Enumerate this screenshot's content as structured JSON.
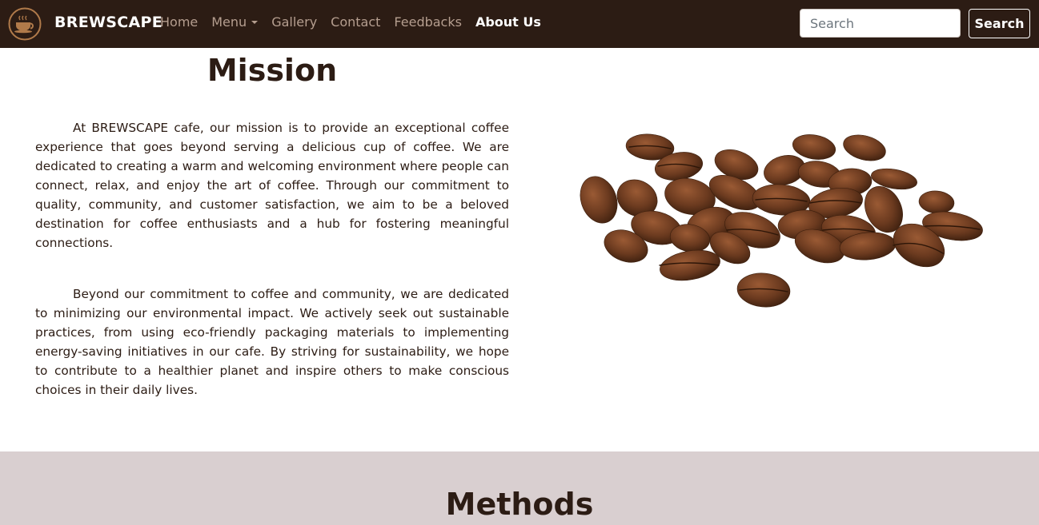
{
  "navbar": {
    "brand": "BREWSCAPE",
    "links": [
      {
        "label": "Home"
      },
      {
        "label": "Menu"
      },
      {
        "label": "Gallery"
      },
      {
        "label": "Contact"
      },
      {
        "label": "Feedbacks"
      },
      {
        "label": "About Us"
      }
    ],
    "search_placeholder": "Search",
    "search_button": "Search",
    "logo_icon": "coffee-cup-icon"
  },
  "mission": {
    "title": "Mission",
    "paragraphs": [
      "At BREWSCAPE cafe, our mission is to provide an exceptional coffee experience that goes beyond serving a delicious cup of coffee. We are dedicated to creating a warm and welcoming environment where people can connect, relax, and enjoy the art of coffee. Through our commitment to quality, community, and customer satisfaction, we aim to be a beloved destination for coffee enthusiasts and a hub for fostering meaningful connections.",
      "Beyond our commitment to coffee and community, we are dedicated to minimizing our environmental impact. We actively seek out sustainable practices, from using eco-friendly packaging materials to implementing energy-saving initiatives in our cafe. By striving for sustainability, we hope to contribute to a healthier planet and inspire others to make conscious choices in their daily lives."
    ],
    "image_icon": "coffee-beans-image"
  },
  "methods": {
    "title": "Methods"
  },
  "colors": {
    "navbar_bg": "#2c1c14",
    "nav_link": "#b59e8f",
    "methods_band": "#d9cfd0",
    "text": "#2c1c14"
  }
}
